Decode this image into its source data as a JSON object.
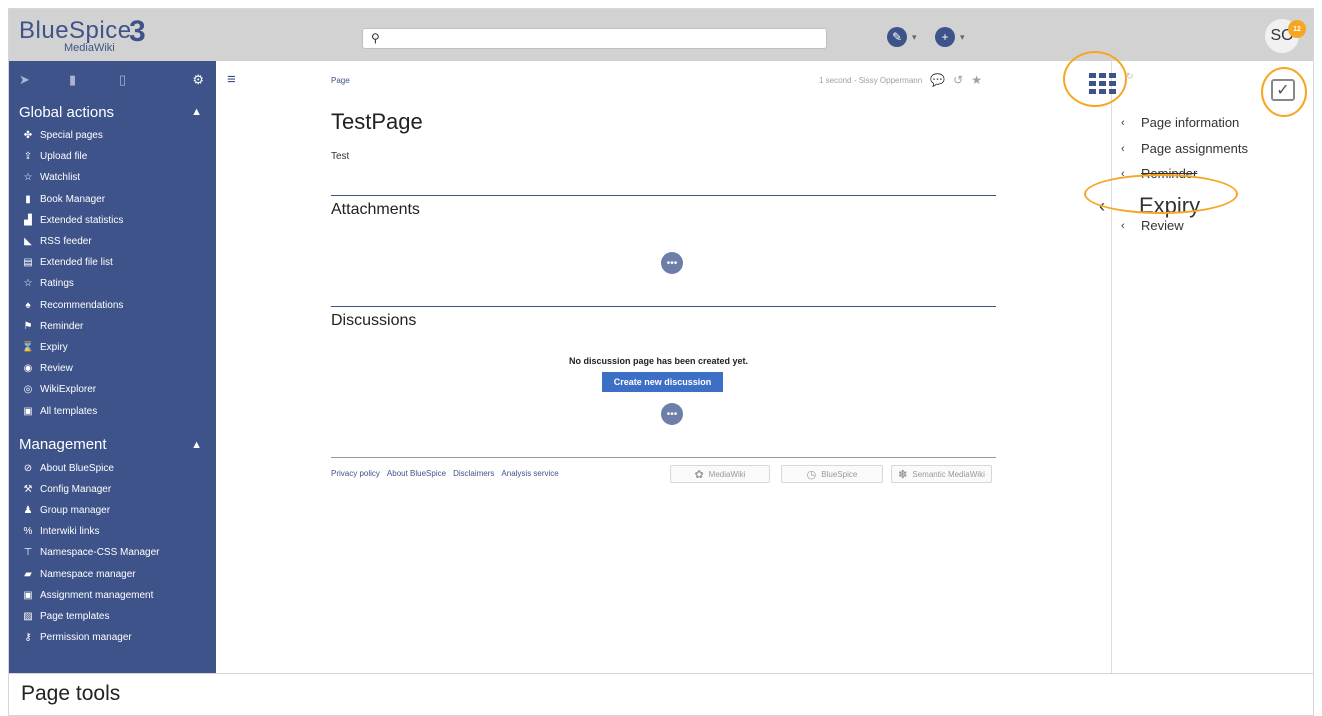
{
  "logo": {
    "main": "BlueSpice",
    "sub": "MediaWiki",
    "version": "3"
  },
  "search": {
    "placeholder": "",
    "icon": "search-icon"
  },
  "topbar": {
    "edit_icon": "pencil-icon",
    "add_icon": "plus-icon",
    "user_initials": "SO",
    "notification_count": "12"
  },
  "sidebar": {
    "tabs": [
      {
        "icon": "navigation-icon"
      },
      {
        "icon": "book-icon"
      },
      {
        "icon": "clipboard-icon"
      },
      {
        "icon": "gear-icon"
      }
    ],
    "global_actions": {
      "title": "Global actions",
      "items": [
        {
          "label": "Special pages",
          "icon": "special-pages-icon",
          "glyph": "✤"
        },
        {
          "label": "Upload file",
          "icon": "upload-icon",
          "glyph": "⇪"
        },
        {
          "label": "Watchlist",
          "icon": "star-icon",
          "glyph": "☆"
        },
        {
          "label": "Book Manager",
          "icon": "book-manager-icon",
          "glyph": "▮"
        },
        {
          "label": "Extended statistics",
          "icon": "chart-icon",
          "glyph": "▟"
        },
        {
          "label": "RSS feeder",
          "icon": "rss-icon",
          "glyph": "◣"
        },
        {
          "label": "Extended file list",
          "icon": "file-list-icon",
          "glyph": "▤"
        },
        {
          "label": "Ratings",
          "icon": "star-outline-icon",
          "glyph": "☆"
        },
        {
          "label": "Recommendations",
          "icon": "recommendations-icon",
          "glyph": "♠"
        },
        {
          "label": "Reminder",
          "icon": "flag-icon",
          "glyph": "⚑"
        },
        {
          "label": "Expiry",
          "icon": "hourglass-icon",
          "glyph": "⌛"
        },
        {
          "label": "Review",
          "icon": "eye-icon",
          "glyph": "◉"
        },
        {
          "label": "WikiExplorer",
          "icon": "compass-icon",
          "glyph": "◎"
        },
        {
          "label": "All templates",
          "icon": "templates-icon",
          "glyph": "▣"
        }
      ]
    },
    "management": {
      "title": "Management",
      "items": [
        {
          "label": "About BlueSpice",
          "icon": "about-icon",
          "glyph": "⊘"
        },
        {
          "label": "Config Manager",
          "icon": "wrench-icon",
          "glyph": "⚒"
        },
        {
          "label": "Group manager",
          "icon": "group-icon",
          "glyph": "♟"
        },
        {
          "label": "Interwiki links",
          "icon": "link-icon",
          "glyph": "%"
        },
        {
          "label": "Namespace-CSS Manager",
          "icon": "paint-icon",
          "glyph": "⊤"
        },
        {
          "label": "Namespace manager",
          "icon": "namespace-icon",
          "glyph": "▰"
        },
        {
          "label": "Assignment management",
          "icon": "assignment-icon",
          "glyph": "▣"
        },
        {
          "label": "Page templates",
          "icon": "page-templates-icon",
          "glyph": "▨"
        },
        {
          "label": "Permission manager",
          "icon": "key-icon",
          "glyph": "⚷"
        }
      ]
    }
  },
  "main": {
    "breadcrumb": "Page",
    "meta": "1 second - Sissy Oppermann",
    "meta_icons": [
      "discussion-icon",
      "history-icon",
      "star-icon"
    ],
    "title": "TestPage",
    "body": "Test",
    "attachments_heading": "Attachments",
    "discussions_heading": "Discussions",
    "no_discussion": "No discussion page has been created yet.",
    "create_button": "Create new discussion",
    "loader_label": "•••"
  },
  "footer": {
    "links": [
      "Privacy policy",
      "About BlueSpice",
      "Disclaimers",
      "Analysis service"
    ],
    "powered": [
      "MediaWiki",
      "BlueSpice",
      "Semantic MediaWiki"
    ]
  },
  "right_panel": {
    "items": [
      {
        "label": "Page information"
      },
      {
        "label": "Page assignments"
      },
      {
        "label": "Reminder"
      },
      {
        "label": "Expiry"
      },
      {
        "label": "Review"
      }
    ]
  },
  "caption": "Page tools",
  "colors": {
    "brand": "#3e5389",
    "highlight": "#f6a623",
    "button": "#3e6fc6"
  }
}
